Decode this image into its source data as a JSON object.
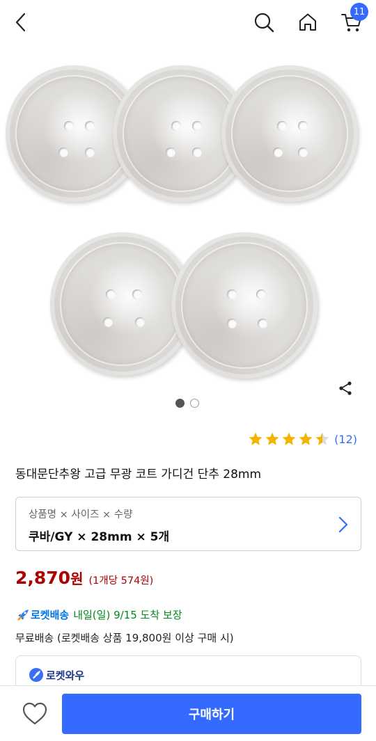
{
  "header": {
    "back_icon": "chevron-left-icon",
    "search_icon": "search-icon",
    "home_icon": "home-icon",
    "cart_icon": "cart-icon",
    "cart_count": "11"
  },
  "gallery": {
    "image_count": 2,
    "active_index": 0,
    "share_icon": "share-icon"
  },
  "rating": {
    "stars": 4.5,
    "review_count": "(12)",
    "star_color": "#f5b301"
  },
  "product": {
    "title": "동대문단추왕 고급 무광 코트 가디건 단추 28mm"
  },
  "option": {
    "label": "상품명 × 사이즈 × 수량",
    "value": "쿠바/GY × 28mm × 5개"
  },
  "price": {
    "amount": "2,870",
    "currency": "원",
    "unit_price": "(1개당 574원)",
    "color": "#ae0000"
  },
  "delivery": {
    "rocket_label": "로켓배송",
    "date_text": "내일(일) 9/15 도착 보장",
    "free_shipping": "무료배송 (로켓배송 상품 19,800원 이상 구매 시)"
  },
  "wow": {
    "label": "로켓와우"
  },
  "bottom": {
    "wish_icon": "heart-icon",
    "buy_label": "구매하기",
    "accent": "#346aff"
  }
}
